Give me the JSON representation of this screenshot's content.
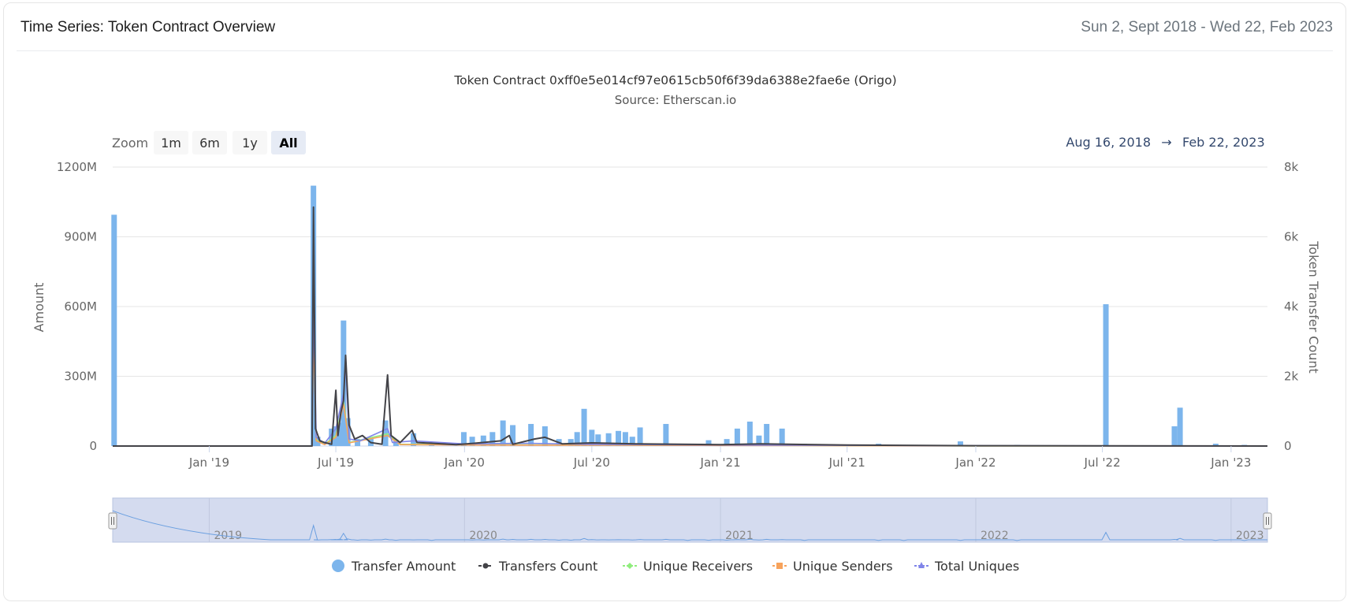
{
  "header": {
    "title": "Time Series: Token Contract Overview",
    "date_range": "Sun 2, Sept 2018 - Wed 22, Feb 2023"
  },
  "zoom": {
    "label": "Zoom",
    "buttons": [
      "1m",
      "6m",
      "1y",
      "All"
    ],
    "selected": "All"
  },
  "range_display": {
    "from": "Aug 16, 2018",
    "arrow": "→",
    "to": "Feb 22, 2023"
  },
  "colors": {
    "transfer_amount": "#7cb5ec",
    "transfers_count": "#434348",
    "unique_receivers": "#90ed7d",
    "unique_senders": "#f7a35c",
    "total_uniques": "#8085e9",
    "navigator_fill": "#d4dbef"
  },
  "chart_data": {
    "type": "bar",
    "title": "Token Contract 0xff0e5e014cf97e0615cb50f6f39da6388e2fae6e (Origo)",
    "subtitle": "Source: Etherscan.io",
    "x_range": [
      "2018-08-16",
      "2023-02-22"
    ],
    "x_ticks": [
      {
        "date": "2019-01-01",
        "label": "Jan '19"
      },
      {
        "date": "2019-07-01",
        "label": "Jul '19"
      },
      {
        "date": "2020-01-01",
        "label": "Jan '20"
      },
      {
        "date": "2020-07-01",
        "label": "Jul '20"
      },
      {
        "date": "2021-01-01",
        "label": "Jan '21"
      },
      {
        "date": "2021-07-01",
        "label": "Jul '21"
      },
      {
        "date": "2022-01-01",
        "label": "Jan '22"
      },
      {
        "date": "2022-07-01",
        "label": "Jul '22"
      },
      {
        "date": "2023-01-01",
        "label": "Jan '23"
      }
    ],
    "y_left": {
      "label": "Amount",
      "min": 0,
      "max": 1200000000,
      "ticks": [
        0,
        300000000,
        600000000,
        900000000,
        1200000000
      ],
      "tick_labels": [
        "0",
        "300M",
        "600M",
        "900M",
        "1200M"
      ]
    },
    "y_right": {
      "label": "Token Transfer Count",
      "min": 0,
      "max": 8000,
      "ticks": [
        0,
        2000,
        4000,
        6000,
        8000
      ],
      "tick_labels": [
        "0",
        "2k",
        "4k",
        "6k",
        "8k"
      ]
    },
    "grid": true,
    "legend_position": "bottom-center",
    "navigator_labels": [
      {
        "date": "2019-01-01",
        "label": "2019"
      },
      {
        "date": "2020-01-01",
        "label": "2020"
      },
      {
        "date": "2021-01-01",
        "label": "2021"
      },
      {
        "date": "2022-01-01",
        "label": "2022"
      },
      {
        "date": "2023-01-01",
        "label": "2023"
      }
    ],
    "series": [
      {
        "name": "Transfer Amount",
        "type": "column",
        "axis": "left",
        "points": [
          [
            "2018-08-18",
            995000000
          ],
          [
            "2019-05-30",
            1120000000
          ],
          [
            "2019-06-05",
            40000000
          ],
          [
            "2019-06-25",
            75000000
          ],
          [
            "2019-06-30",
            85000000
          ],
          [
            "2019-07-06",
            100000000
          ],
          [
            "2019-07-12",
            540000000
          ],
          [
            "2019-07-18",
            120000000
          ],
          [
            "2019-08-01",
            30000000
          ],
          [
            "2019-08-20",
            35000000
          ],
          [
            "2019-09-10",
            110000000
          ],
          [
            "2019-09-25",
            25000000
          ],
          [
            "2019-10-20",
            55000000
          ],
          [
            "2019-11-15",
            10000000
          ],
          [
            "2019-12-31",
            60000000
          ],
          [
            "2020-01-12",
            40000000
          ],
          [
            "2020-01-28",
            45000000
          ],
          [
            "2020-02-10",
            60000000
          ],
          [
            "2020-02-25",
            110000000
          ],
          [
            "2020-03-10",
            90000000
          ],
          [
            "2020-04-05",
            95000000
          ],
          [
            "2020-04-25",
            85000000
          ],
          [
            "2020-05-15",
            30000000
          ],
          [
            "2020-06-01",
            30000000
          ],
          [
            "2020-06-10",
            60000000
          ],
          [
            "2020-06-20",
            160000000
          ],
          [
            "2020-07-01",
            70000000
          ],
          [
            "2020-07-10",
            50000000
          ],
          [
            "2020-07-25",
            55000000
          ],
          [
            "2020-08-08",
            65000000
          ],
          [
            "2020-08-18",
            60000000
          ],
          [
            "2020-08-28",
            40000000
          ],
          [
            "2020-09-08",
            80000000
          ],
          [
            "2020-10-15",
            95000000
          ],
          [
            "2020-11-15",
            10000000
          ],
          [
            "2020-12-15",
            25000000
          ],
          [
            "2021-01-10",
            30000000
          ],
          [
            "2021-01-25",
            75000000
          ],
          [
            "2021-02-12",
            105000000
          ],
          [
            "2021-02-25",
            45000000
          ],
          [
            "2021-03-08",
            95000000
          ],
          [
            "2021-03-30",
            75000000
          ],
          [
            "2021-05-01",
            10000000
          ],
          [
            "2021-08-15",
            10000000
          ],
          [
            "2021-09-20",
            5000000
          ],
          [
            "2021-12-10",
            20000000
          ],
          [
            "2022-03-01",
            5000000
          ],
          [
            "2022-07-06",
            610000000
          ],
          [
            "2022-10-12",
            85000000
          ],
          [
            "2022-10-20",
            165000000
          ],
          [
            "2022-12-10",
            10000000
          ],
          [
            "2023-01-20",
            5000000
          ]
        ]
      },
      {
        "name": "Transfers Count",
        "type": "line",
        "axis": "right",
        "points": [
          [
            "2018-08-16",
            0
          ],
          [
            "2019-05-28",
            0
          ],
          [
            "2019-05-30",
            6850
          ],
          [
            "2019-06-02",
            500
          ],
          [
            "2019-06-08",
            150
          ],
          [
            "2019-06-15",
            100
          ],
          [
            "2019-06-25",
            50
          ],
          [
            "2019-07-01",
            1600
          ],
          [
            "2019-07-04",
            300
          ],
          [
            "2019-07-08",
            950
          ],
          [
            "2019-07-12",
            1300
          ],
          [
            "2019-07-15",
            2600
          ],
          [
            "2019-07-20",
            600
          ],
          [
            "2019-07-28",
            200
          ],
          [
            "2019-08-08",
            300
          ],
          [
            "2019-08-20",
            100
          ],
          [
            "2019-09-05",
            50
          ],
          [
            "2019-09-13",
            2040
          ],
          [
            "2019-09-18",
            300
          ],
          [
            "2019-10-01",
            100
          ],
          [
            "2019-10-18",
            450
          ],
          [
            "2019-10-25",
            100
          ],
          [
            "2019-11-15",
            80
          ],
          [
            "2019-12-20",
            40
          ],
          [
            "2020-01-15",
            80
          ],
          [
            "2020-02-22",
            150
          ],
          [
            "2020-03-05",
            300
          ],
          [
            "2020-03-10",
            50
          ],
          [
            "2020-04-10",
            200
          ],
          [
            "2020-04-25",
            250
          ],
          [
            "2020-05-20",
            60
          ],
          [
            "2020-07-01",
            90
          ],
          [
            "2020-09-01",
            60
          ],
          [
            "2021-01-01",
            40
          ],
          [
            "2021-03-01",
            60
          ],
          [
            "2021-07-01",
            30
          ],
          [
            "2022-01-01",
            10
          ],
          [
            "2023-02-22",
            0
          ]
        ]
      },
      {
        "name": "Unique Receivers",
        "type": "line",
        "axis": "right",
        "points": [
          [
            "2018-08-16",
            0
          ],
          [
            "2019-05-28",
            0
          ],
          [
            "2019-05-30",
            3400
          ],
          [
            "2019-06-03",
            180
          ],
          [
            "2019-06-15",
            50
          ],
          [
            "2019-07-01",
            300
          ],
          [
            "2019-07-12",
            1300
          ],
          [
            "2019-07-20",
            100
          ],
          [
            "2019-09-13",
            350
          ],
          [
            "2019-10-01",
            50
          ],
          [
            "2020-01-01",
            40
          ],
          [
            "2020-06-01",
            30
          ],
          [
            "2021-01-01",
            20
          ],
          [
            "2022-01-01",
            5
          ],
          [
            "2023-02-22",
            0
          ]
        ]
      },
      {
        "name": "Unique Senders",
        "type": "line",
        "axis": "right",
        "points": [
          [
            "2018-08-16",
            0
          ],
          [
            "2019-05-28",
            0
          ],
          [
            "2019-05-30",
            3200
          ],
          [
            "2019-06-03",
            150
          ],
          [
            "2019-06-15",
            40
          ],
          [
            "2019-07-01",
            250
          ],
          [
            "2019-07-12",
            1200
          ],
          [
            "2019-07-20",
            90
          ],
          [
            "2019-09-13",
            300
          ],
          [
            "2019-10-01",
            40
          ],
          [
            "2020-01-01",
            30
          ],
          [
            "2020-06-01",
            25
          ],
          [
            "2021-01-01",
            15
          ],
          [
            "2022-01-01",
            5
          ],
          [
            "2023-02-22",
            0
          ]
        ]
      },
      {
        "name": "Total Uniques",
        "type": "line",
        "axis": "right",
        "points": [
          [
            "2018-08-16",
            0
          ],
          [
            "2019-05-28",
            0
          ],
          [
            "2019-05-30",
            4000
          ],
          [
            "2019-06-03",
            250
          ],
          [
            "2019-06-15",
            80
          ],
          [
            "2019-07-01",
            500
          ],
          [
            "2019-07-12",
            1500
          ],
          [
            "2019-07-15",
            2400
          ],
          [
            "2019-07-20",
            200
          ],
          [
            "2019-08-05",
            150
          ],
          [
            "2019-09-13",
            500
          ],
          [
            "2019-09-20",
            100
          ],
          [
            "2019-10-20",
            150
          ],
          [
            "2020-01-01",
            60
          ],
          [
            "2020-04-01",
            80
          ],
          [
            "2020-07-01",
            50
          ],
          [
            "2021-01-01",
            30
          ],
          [
            "2022-01-01",
            10
          ],
          [
            "2023-02-22",
            0
          ]
        ]
      }
    ]
  }
}
